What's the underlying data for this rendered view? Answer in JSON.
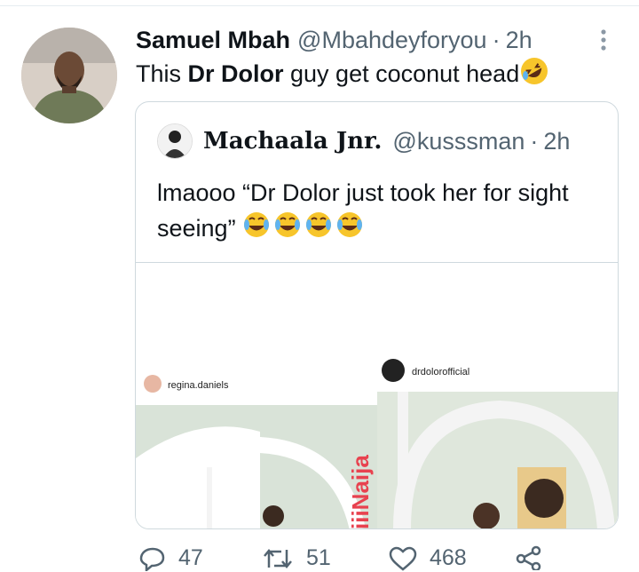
{
  "tweet": {
    "author_name": "Samuel Mbah",
    "author_handle": "@Mbahdeyforyou",
    "separator": "·",
    "time": "2h",
    "text_prefix": "This ",
    "text_bold": "Dr Dolor",
    "text_suffix": " guy get coconut head",
    "emoji": "rolling-on-floor-laughing-emoji"
  },
  "quote": {
    "author_name": "Machaala Jnr.",
    "author_handle": "@kusssman",
    "separator": "·",
    "time": "2h",
    "text": "lmaooo “Dr Dolor just took her for sight seeing”",
    "emoji_count": 4,
    "media": {
      "left_username": "regina.daniels",
      "right_username": "drdolorofficial",
      "watermark": "iiiNaija"
    }
  },
  "actions": {
    "replies": "47",
    "retweets": "51",
    "likes": "468"
  },
  "colors": {
    "text": "#0f1419",
    "secondary": "#536471",
    "border": "#cfd9de"
  }
}
